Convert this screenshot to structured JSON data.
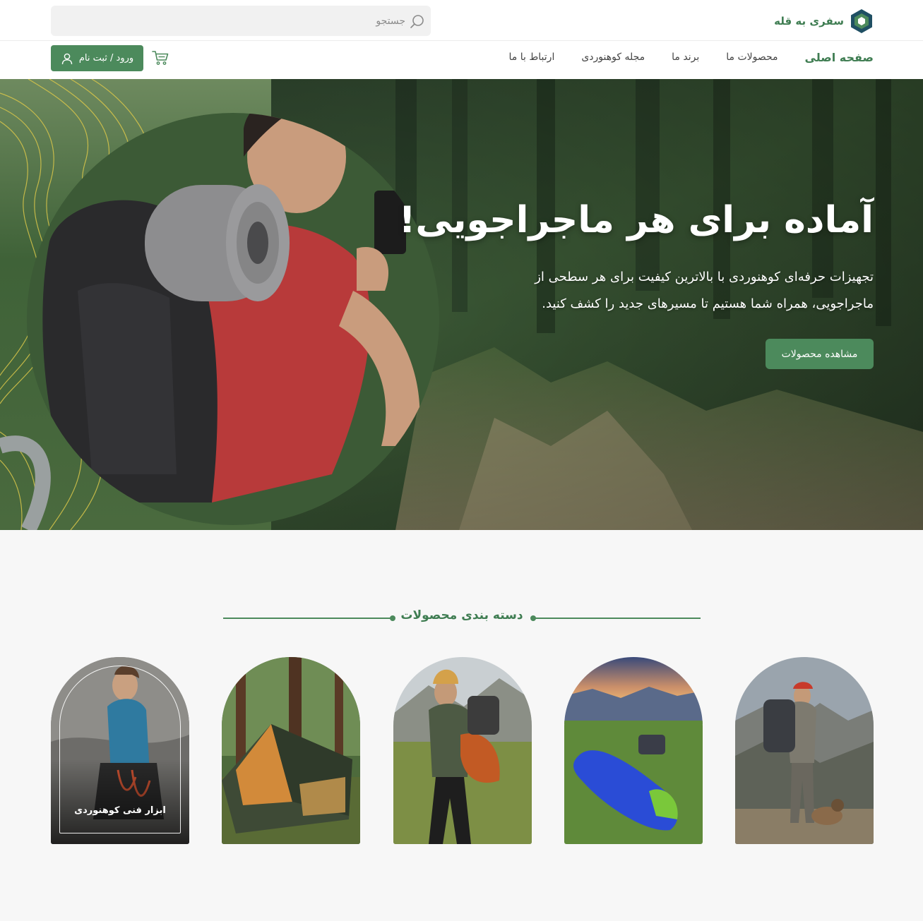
{
  "brand": {
    "name": "سفری به قله",
    "accent": "#4c8a5c"
  },
  "search": {
    "placeholder": "جستجو",
    "icon": "search-icon"
  },
  "nav": {
    "items": [
      {
        "label": "صفحه اصلی",
        "active": true
      },
      {
        "label": "محصولات ما",
        "active": false
      },
      {
        "label": "برند ما",
        "active": false
      },
      {
        "label": "مجله کوهنوردی",
        "active": false
      },
      {
        "label": "ارتباط با ما",
        "active": false
      }
    ]
  },
  "account": {
    "login_label": "ورود / ثبت نام",
    "icon": "user-icon",
    "cart_icon": "cart-icon"
  },
  "hero": {
    "title": "آماده برای هر ماجراجویی!",
    "description": "تجهیزات حرفه‌ای کوهنوردی با بالاترین کیفیت برای هر سطحی از ماجراجویی، همراه شما هستیم تا مسیرهای جدید را کشف کنید.",
    "cta_label": "مشاهده محصولات"
  },
  "categories": {
    "title": "دسته بندی محصولات",
    "items": [
      {
        "label": "ابزار فنی کوهنوردی",
        "image": "climber-with-gear",
        "highlighted": true
      },
      {
        "label": "",
        "image": "tent-in-forest",
        "highlighted": false
      },
      {
        "label": "",
        "image": "hiker-with-jacket",
        "highlighted": false
      },
      {
        "label": "",
        "image": "sleeping-bag-on-meadow",
        "highlighted": false
      },
      {
        "label": "",
        "image": "backpacker-with-dog",
        "highlighted": false
      }
    ]
  }
}
